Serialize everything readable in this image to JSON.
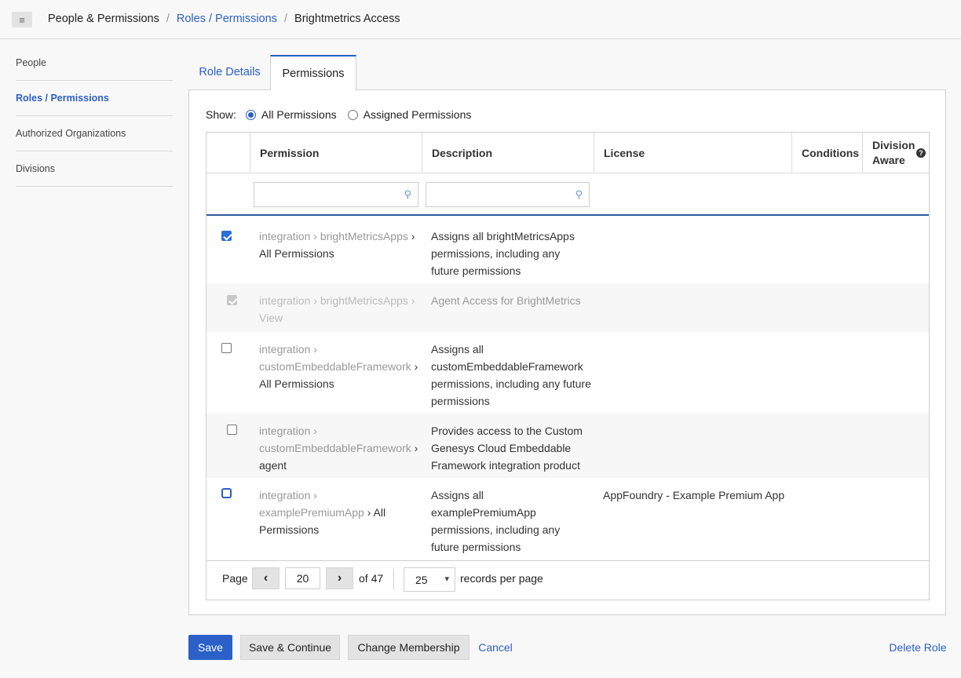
{
  "breadcrumb": {
    "menu_icon": "hamburger-icon",
    "items": [
      "People & Permissions",
      "Roles / Permissions",
      "Brightmetrics Access"
    ]
  },
  "sidebar": {
    "items": [
      {
        "label": "People",
        "active": false
      },
      {
        "label": "Roles / Permissions",
        "active": true
      },
      {
        "label": "Authorized Organizations",
        "active": false
      },
      {
        "label": "Divisions",
        "active": false
      }
    ]
  },
  "tabs": [
    {
      "label": "Role Details",
      "active": false
    },
    {
      "label": "Permissions",
      "active": true
    }
  ],
  "show": {
    "label": "Show:",
    "options": [
      {
        "label": "All Permissions",
        "selected": true
      },
      {
        "label": "Assigned Permissions",
        "selected": false
      }
    ]
  },
  "table": {
    "headers": {
      "permission": "Permission",
      "description": "Description",
      "license": "License",
      "conditions": "Conditions",
      "division_aware": "Division Aware"
    },
    "filters": {
      "permission": "",
      "description": ""
    },
    "rows": [
      {
        "checked": true,
        "disabled": false,
        "perm_path": "integration › brightMetricsApps",
        "perm_leaf": "› All Permissions",
        "description": "Assigns all brightMetricsApps permissions, including any future permissions",
        "license": ""
      },
      {
        "checked": true,
        "disabled": true,
        "perm_path": "integration › brightMetricsApps",
        "perm_leaf": "› View",
        "description": "Agent Access for BrightMetrics",
        "license": ""
      },
      {
        "checked": false,
        "disabled": false,
        "perm_path": "integration › customEmbeddableFramework",
        "perm_leaf": "› All Permissions",
        "description": "Assigns all customEmbeddableFramework permissions, including any future permissions",
        "license": ""
      },
      {
        "checked": false,
        "disabled": false,
        "perm_path": "integration › customEmbeddableFramework",
        "perm_leaf": "› agent",
        "description": "Provides access to the Custom Genesys Cloud Embeddable Framework integration product",
        "license": ""
      },
      {
        "checked": false,
        "disabled": false,
        "perm_path": "integration › examplePremiumApp",
        "perm_leaf": "› All Permissions",
        "description": "Assigns all examplePremiumApp permissions, including any future permissions",
        "license": "AppFoundry - Example Premium App"
      }
    ]
  },
  "pager": {
    "label": "Page",
    "current_page": "20",
    "of_text": "of 47",
    "per_page": "25",
    "per_page_label": "records per page"
  },
  "actions": {
    "save": "Save",
    "save_continue": "Save & Continue",
    "change_membership": "Change Membership",
    "cancel": "Cancel",
    "delete_role": "Delete Role"
  },
  "colors": {
    "accent": "#2a60c8",
    "checkbox": "#2a6fd8"
  }
}
